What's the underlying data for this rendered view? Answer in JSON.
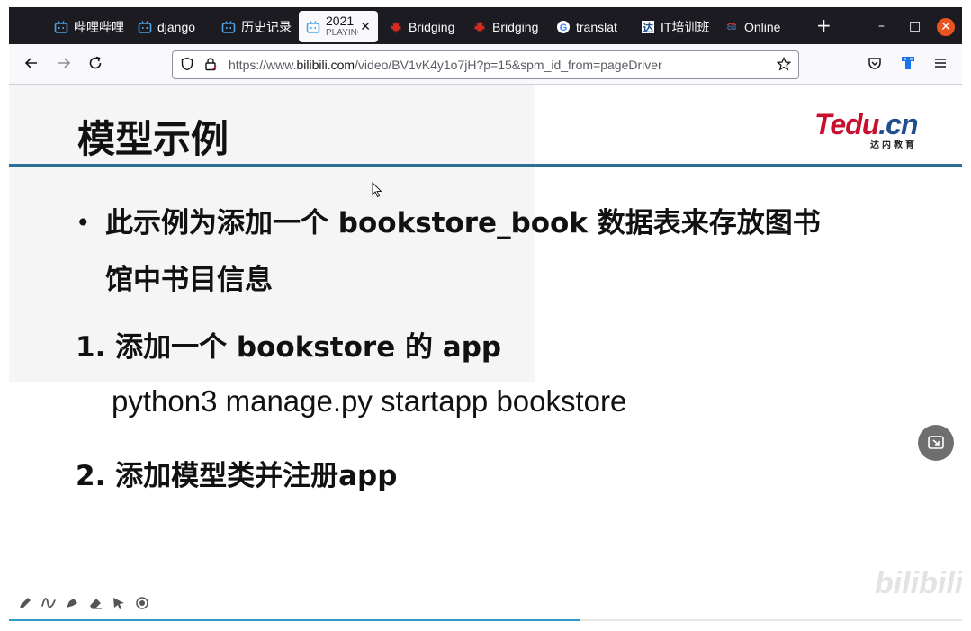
{
  "browser": {
    "tabs": [
      {
        "label": "哔哩哔哩",
        "icon": "bilibili-icon",
        "active": false
      },
      {
        "label": "django",
        "icon": "bilibili-icon",
        "active": false
      },
      {
        "label": "历史记录",
        "icon": "bilibili-icon",
        "active": false
      },
      {
        "label": "2021",
        "sub": "PLAYING",
        "icon": "bilibili-icon",
        "active": true
      },
      {
        "label": "Bridging",
        "icon": "maple-leaf-icon",
        "active": false
      },
      {
        "label": "Bridging",
        "icon": "maple-leaf-icon",
        "active": false
      },
      {
        "label": "translat",
        "icon": "google-icon",
        "active": false
      },
      {
        "label": "IT培训班",
        "icon": "da-icon",
        "active": false
      },
      {
        "label": "Online",
        "icon": "citi-icon",
        "active": false
      }
    ],
    "new_tab_label": "+",
    "window_controls": {
      "minimize": "–",
      "maximize": "□",
      "close": "✕"
    },
    "url_prefix": "https://www.",
    "url_domain": "bilibili.com",
    "url_path": "/video/BV1vK4y1o7jH?p=15&spm_id_from=pageDriver"
  },
  "slide": {
    "title": "模型示例",
    "logo_main": "Tedu",
    "logo_suffix": ".cn",
    "logo_sub": "达内教育",
    "bullet_line_1": "此示例为添加一个 bookstore_book 数据表来存放图书",
    "bullet_line_2": "馆中书目信息",
    "step1": "1.  添加一个 bookstore 的 app",
    "code": "python3 manage.py startapp bookstore",
    "step2": "2.  添加模型类并注册app",
    "watermark": "bilibili",
    "progress": 0.6
  },
  "colors": {
    "tabbar_bg": "#1c1b22",
    "title_rule": "#2b6f94",
    "progress_fill": "#2b9bc9",
    "logo_red": "#c8102e",
    "logo_blue": "#1f4e8c"
  }
}
